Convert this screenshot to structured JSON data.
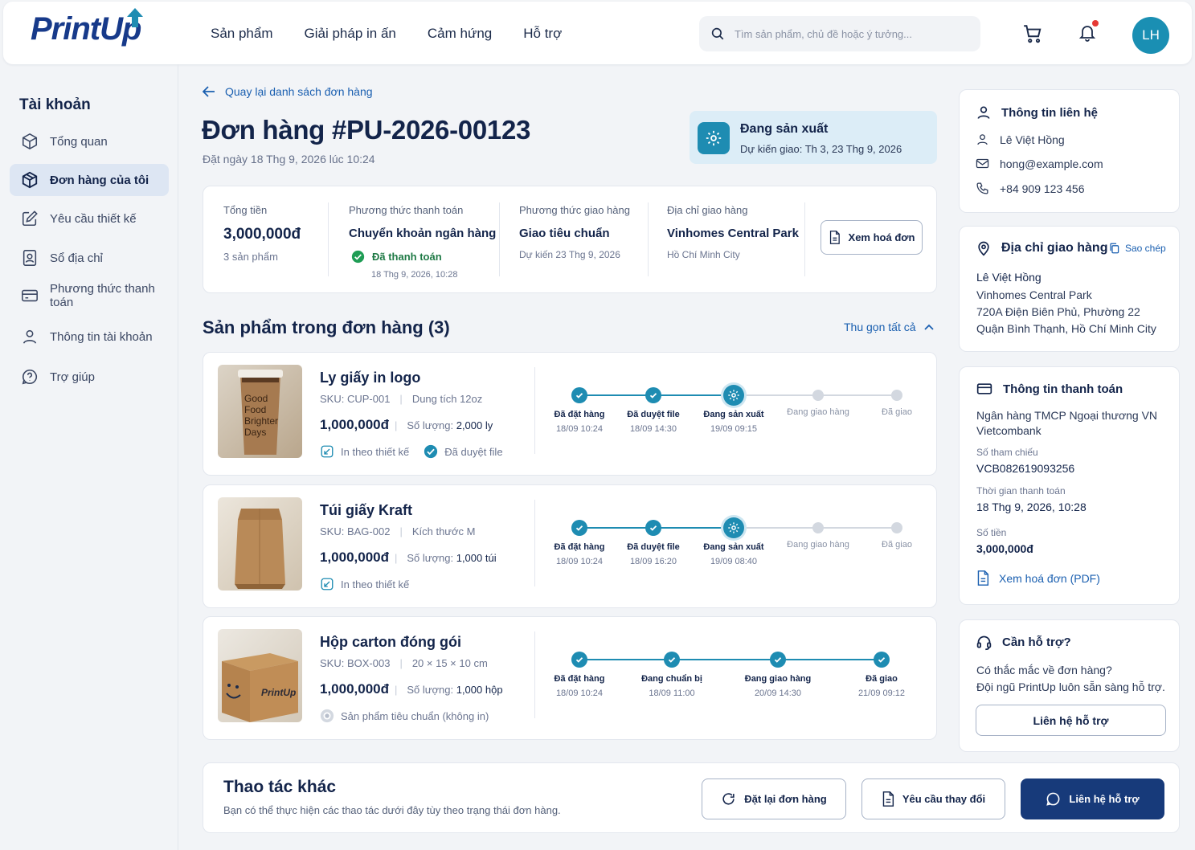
{
  "header": {
    "logo": "PrintUp",
    "nav": [
      "Sản phẩm",
      "Giải pháp in ấn",
      "Cảm hứng",
      "Hỗ trợ"
    ],
    "search_placeholder": "Tìm sản phẩm, chủ đề hoặc ý tưởng...",
    "avatar_initials": "LH"
  },
  "sidebar": {
    "title": "Tài khoản",
    "items": [
      {
        "label": "Tổng quan",
        "icon": "box-icon"
      },
      {
        "label": "Đơn hàng của tôi",
        "icon": "package-icon",
        "active": true
      },
      {
        "label": "Yêu cầu thiết kế",
        "icon": "edit-icon"
      },
      {
        "label": "Sổ địa chỉ",
        "icon": "address-book-icon"
      },
      {
        "label": "Phương thức thanh toán",
        "icon": "credit-card-icon"
      },
      {
        "label": "Thông tin tài khoản",
        "icon": "user-icon"
      },
      {
        "label": "Trợ giúp",
        "icon": "help-icon"
      }
    ]
  },
  "order": {
    "back_label": "Quay lại danh sách đơn hàng",
    "title": "Đơn hàng #PU-2026-00123",
    "placed": "Đặt ngày 18 Thg 9, 2026 lúc 10:24",
    "status": "Đang sản xuất",
    "expected": "Dự kiến giao: Th 3, 23 Thg 9, 2026"
  },
  "summary": {
    "total_label": "Tổng tiền",
    "total_value": "3,000,000đ",
    "total_count": "3 sản phẩm",
    "pay_label": "Phương thức thanh toán",
    "pay_value": "Chuyển khoản ngân hàng",
    "pay_status": "Đã thanh toán",
    "pay_time": "18 Thg 9, 2026, 10:28",
    "ship_label": "Phương thức giao hàng",
    "ship_value": "Giao tiêu chuẩn",
    "ship_eta": "Dự kiến 23 Thg 9, 2026",
    "addr_label": "Địa chỉ giao hàng",
    "addr_value": "Vinhomes Central Park",
    "addr_city": "Hồ Chí Minh City",
    "invoice_button": "Xem hoá đơn"
  },
  "products_section": {
    "title": "Sản phẩm trong đơn hàng (3)",
    "collapse_label": "Thu gọn tất cả"
  },
  "products": [
    {
      "name": "Ly giấy in logo",
      "sku": "SKU: CUP-001",
      "spec": "Dung tích 12oz",
      "price": "1,000,000đ",
      "qty_label": "Số lượng:",
      "qty": "2,000 ly",
      "tag1": "In theo thiết kế",
      "tag2": "Đã duyệt file",
      "cup_text": "Good Food Brighter Days",
      "steps": [
        {
          "label": "Đã đặt hàng",
          "time": "18/09 10:24",
          "state": "done"
        },
        {
          "label": "Đã duyệt file",
          "time": "18/09 14:30",
          "state": "done"
        },
        {
          "label": "Đang sản xuất",
          "time": "19/09 09:15",
          "state": "current"
        },
        {
          "label": "Đang giao hàng",
          "time": "",
          "state": "todo"
        },
        {
          "label": "Đã giao",
          "time": "",
          "state": "todo"
        }
      ]
    },
    {
      "name": "Túi giấy Kraft",
      "sku": "SKU: BAG-002",
      "spec": "Kích thước M",
      "price": "1,000,000đ",
      "qty_label": "Số lượng:",
      "qty": "1,000 túi",
      "tag1": "In theo thiết kế",
      "steps": [
        {
          "label": "Đã đặt hàng",
          "time": "18/09 10:24",
          "state": "done"
        },
        {
          "label": "Đã duyệt file",
          "time": "18/09 16:20",
          "state": "done"
        },
        {
          "label": "Đang sản xuất",
          "time": "19/09 08:40",
          "state": "current"
        },
        {
          "label": "Đang giao hàng",
          "time": "",
          "state": "todo"
        },
        {
          "label": "Đã giao",
          "time": "",
          "state": "todo"
        }
      ]
    },
    {
      "name": "Hộp carton đóng gói",
      "sku": "SKU: BOX-003",
      "spec": "20 × 15 × 10 cm",
      "price": "1,000,000đ",
      "qty_label": "Số lượng:",
      "qty": "1,000 hộp",
      "tag1": "Sản phẩm tiêu chuẩn (không in)",
      "box_logo": "PrintUp",
      "steps": [
        {
          "label": "Đã đặt hàng",
          "time": "18/09 10:24",
          "state": "done"
        },
        {
          "label": "Đang chuẩn bị",
          "time": "18/09 11:00",
          "state": "done"
        },
        {
          "label": "Đang giao hàng",
          "time": "20/09 14:30",
          "state": "done"
        },
        {
          "label": "Đã giao",
          "time": "21/09 09:12",
          "state": "done"
        }
      ]
    }
  ],
  "actions": {
    "title": "Thao tác khác",
    "subtitle": "Bạn có thể thực hiện các thao tác dưới đây tùy theo trạng thái đơn hàng.",
    "reorder": "Đặt lại đơn hàng",
    "request_change": "Yêu cầu thay đổi",
    "contact": "Liên hệ hỗ trợ"
  },
  "contact": {
    "title": "Thông tin liên hệ",
    "name": "Lê Việt Hồng",
    "email": "hong@example.com",
    "phone": "+84 909 123 456"
  },
  "shipping": {
    "title": "Địa chỉ giao hàng",
    "copy": "Sao chép",
    "name": "Lê Việt Hồng",
    "line1": "Vinhomes Central Park",
    "line2": "720A Điện Biên Phủ, Phường 22",
    "line3": "Quận Bình Thạnh, Hồ Chí Minh City"
  },
  "payment": {
    "title": "Thông tin thanh toán",
    "bank": "Ngân hàng TMCP Ngoại thương VN",
    "bank2": "Vietcombank",
    "ref_label": "Số tham chiếu",
    "ref": "VCB082619093256",
    "time_label": "Thời gian thanh toán",
    "time": "18 Thg 9, 2026, 10:28",
    "amount_label": "Số tiền",
    "amount": "3,000,000đ",
    "invoice_link": "Xem hoá đơn (PDF)"
  },
  "support": {
    "title": "Cần hỗ trợ?",
    "line1": "Có thắc mắc về đơn hàng?",
    "line2": "Đội ngũ PrintUp luôn sẵn sàng hỗ trợ.",
    "button": "Liên hệ hỗ trợ"
  },
  "colors": {
    "accent": "#1e8cb2",
    "navy": "#173a7a",
    "link": "#1a5fb0",
    "success": "#1f9d55"
  }
}
